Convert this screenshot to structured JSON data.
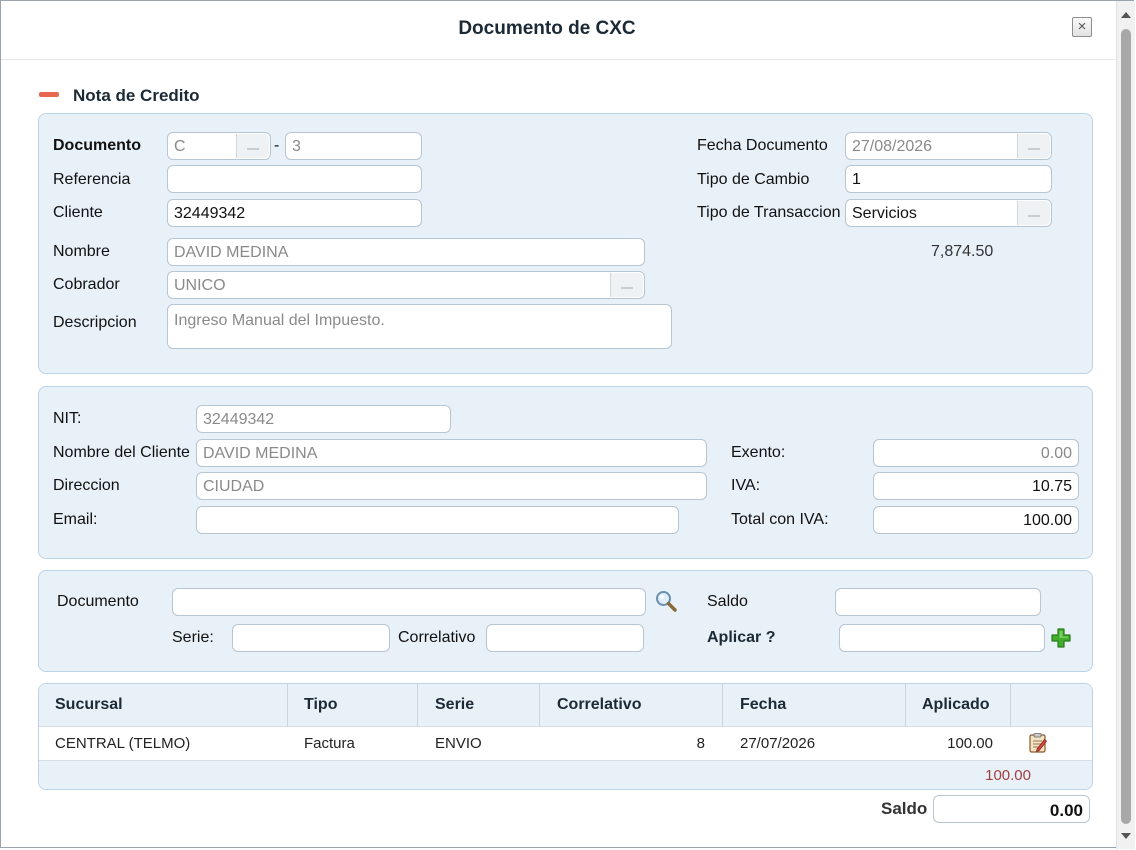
{
  "dialog": {
    "title": "Documento de CXC",
    "close_label": "×"
  },
  "section": {
    "title": "Nota de Credito"
  },
  "header": {
    "documento_label": "Documento",
    "documento_serie": "C",
    "documento_separator": "-",
    "documento_numero": "3",
    "referencia_label": "Referencia",
    "referencia_value": "",
    "cliente_label": "Cliente",
    "cliente_value": "32449342",
    "nombre_label": "Nombre",
    "nombre_value": "DAVID MEDINA",
    "cobrador_label": "Cobrador",
    "cobrador_value": "UNICO",
    "descripcion_label": "Descripcion",
    "descripcion_value": "Ingreso Manual del Impuesto.",
    "fecha_label": "Fecha Documento",
    "fecha_value": "27/08/2026",
    "tipo_cambio_label": "Tipo de Cambio",
    "tipo_cambio_value": "1",
    "tipo_transaccion_label": "Tipo de Transaccion",
    "tipo_transaccion_value": "Servicios",
    "monto_display": "7,874.50"
  },
  "cliente_info": {
    "nit_label": "NIT:",
    "nit_value": "32449342",
    "nombre_cliente_label": "Nombre del Cliente",
    "nombre_cliente_value": "DAVID MEDINA",
    "direccion_label": "Direccion",
    "direccion_value": "CIUDAD",
    "email_label": "Email:",
    "email_value": "",
    "exento_label": "Exento:",
    "exento_value": "0.00",
    "iva_label": "IVA:",
    "iva_value": "10.75",
    "total_iva_label": "Total con IVA:",
    "total_iva_value": "100.00"
  },
  "aplicacion": {
    "documento_label": "Documento",
    "documento_value": "",
    "saldo_label": "Saldo",
    "saldo_value": "",
    "serie_label": "Serie:",
    "serie_value": "",
    "correlativo_label": "Correlativo",
    "correlativo_value": "",
    "aplicar_label": "Aplicar ?",
    "aplicar_value": ""
  },
  "grid": {
    "columns": [
      "Sucursal",
      "Tipo",
      "Serie",
      "Correlativo",
      "Fecha",
      "Aplicado"
    ],
    "rows": [
      {
        "sucursal": "CENTRAL (TELMO)",
        "tipo": "Factura",
        "serie": "ENVIO",
        "correlativo": "8",
        "fecha": "27/07/2026",
        "aplicado": "100.00"
      }
    ],
    "total_aplicado": "100.00"
  },
  "footer": {
    "saldo_label": "Saldo",
    "saldo_value": "0.00"
  },
  "colors": {
    "panel_bg": "#e8f0f8",
    "panel_border": "#bcd4e8",
    "accent_red": "#e8684f",
    "total_color": "#a04040",
    "add_green": "#3fae2a"
  }
}
